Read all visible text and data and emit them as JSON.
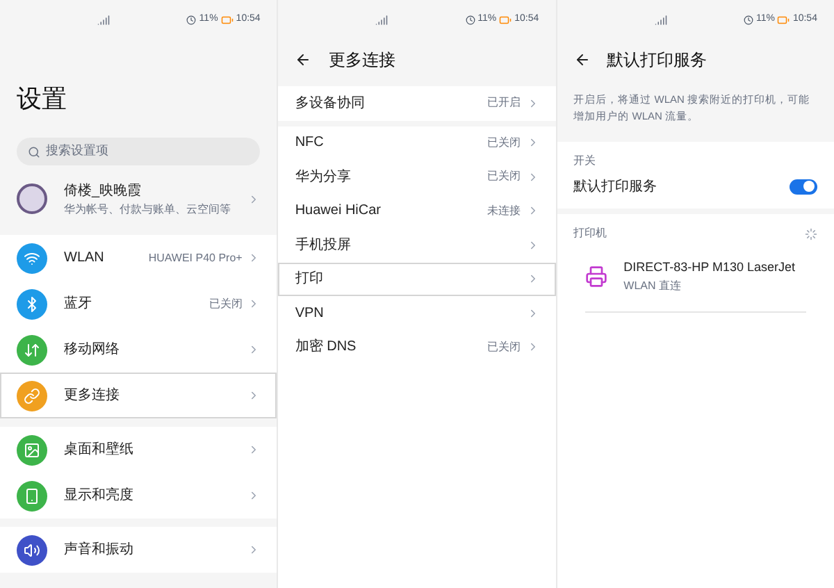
{
  "screens": [
    {
      "kind": "settings",
      "status": {
        "battery": "11%",
        "time": "10:54"
      },
      "title": "设置",
      "search": {
        "placeholder": "搜索设置项"
      },
      "profile": {
        "name": "倚楼_映晚霞",
        "subtitle": "华为帐号、付款与账单、云空间等"
      },
      "groups": [
        [
          {
            "label": "WLAN",
            "value": "HUAWEI P40 Pro+",
            "color": "#1e9be8",
            "selected": false
          },
          {
            "label": "蓝牙",
            "value": "已关闭",
            "color": "#1e9be8",
            "selected": false
          },
          {
            "label": "移动网络",
            "color": "#3db44a",
            "selected": false
          },
          {
            "label": "更多连接",
            "color": "#f0a020",
            "selected": true
          }
        ],
        [
          {
            "label": "桌面和壁纸",
            "color": "#3db44a",
            "selected": false
          },
          {
            "label": "显示和亮度",
            "color": "#3db44a",
            "selected": false
          }
        ],
        [
          {
            "label": "声音和振动",
            "color": "#3f51c8",
            "selected": false
          }
        ]
      ]
    },
    {
      "kind": "list",
      "status": {
        "battery": "11%",
        "time": "10:54"
      },
      "title": "更多连接",
      "groups": [
        [
          {
            "label": "多设备协同",
            "value": "已开启",
            "selected": false
          }
        ],
        [
          {
            "label": "NFC",
            "value": "已关闭",
            "selected": false
          },
          {
            "label": "华为分享",
            "value": "已关闭",
            "selected": false
          },
          {
            "label": "Huawei HiCar",
            "value": "未连接",
            "selected": false
          },
          {
            "label": "手机投屏",
            "selected": false
          },
          {
            "label": "打印",
            "selected": true
          },
          {
            "label": "VPN",
            "selected": false
          },
          {
            "label": "加密 DNS",
            "value": "已关闭",
            "selected": false
          }
        ]
      ]
    },
    {
      "kind": "print",
      "status": {
        "battery": "11%",
        "time": "10:54"
      },
      "title": "默认打印服务",
      "description": "开启后，将通过 WLAN 搜索附近的打印机，可能增加用户的 WLAN 流量。",
      "switch_section": "开关",
      "switch": {
        "label": "默认打印服务",
        "on": true
      },
      "printers_section": "打印机",
      "printers": [
        {
          "name": "DIRECT-83-HP M130 LaserJet",
          "connection": "WLAN 直连"
        }
      ]
    }
  ]
}
